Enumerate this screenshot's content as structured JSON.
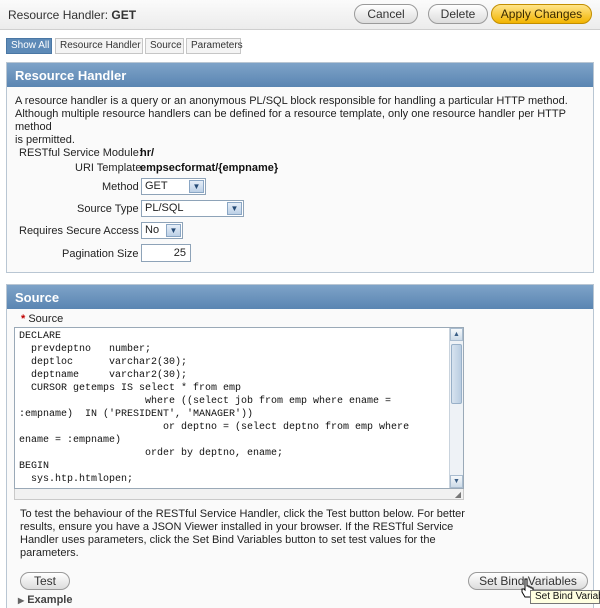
{
  "header": {
    "title_prefix": "Resource Handler: ",
    "title_value": "GET",
    "buttons": {
      "cancel": "Cancel",
      "delete": "Delete",
      "apply": "Apply Changes"
    }
  },
  "tabs": [
    "Show All",
    "Resource Handler",
    "Source",
    "Parameters"
  ],
  "resource_handler": {
    "heading": "Resource Handler",
    "description": [
      "A resource handler is a query or an anonymous PL/SQL block responsible for handling a particular HTTP method.",
      "Although multiple resource handlers can be defined for a resource template, only one resource handler per HTTP method",
      "is permitted."
    ],
    "module_label": "RESTful Service Module:",
    "module_value": "hr/",
    "uri_label": "URI Template:",
    "uri_value": "empsecformat/{empname}",
    "method_label": "Method",
    "method_value": "GET",
    "source_type_label": "Source Type",
    "source_type_value": "PL/SQL",
    "secure_label": "Requires Secure Access",
    "secure_value": "No",
    "pagination_label": "Pagination Size",
    "pagination_value": "25"
  },
  "source": {
    "heading": "Source",
    "required_mark": "*",
    "label": "Source",
    "code": [
      "DECLARE",
      "  prevdeptno   number;",
      "  deptloc      varchar2(30);",
      "  deptname     varchar2(30);",
      "  CURSOR getemps IS select * from emp",
      "                     where ((select job from emp where ename =",
      ":empname)  IN ('PRESIDENT', 'MANAGER'))",
      "                        or deptno = (select deptno from emp where",
      "ename = :empname)",
      "                     order by deptno, ename;",
      "BEGIN",
      "  sys.htp.htmlopen;"
    ],
    "help": [
      "To test the behaviour of the RESTful Service Handler, click the Test button below. For better",
      "results, ensure you have a JSON Viewer installed in your browser. If the RESTful Service",
      "Handler uses parameters, click the Set Bind Variables button to set test values for the",
      "parameters."
    ],
    "test_button": "Test",
    "bind_button": "Set Bind Variables",
    "example_label": "Example",
    "tooltip": "Set Bind Variables"
  }
}
